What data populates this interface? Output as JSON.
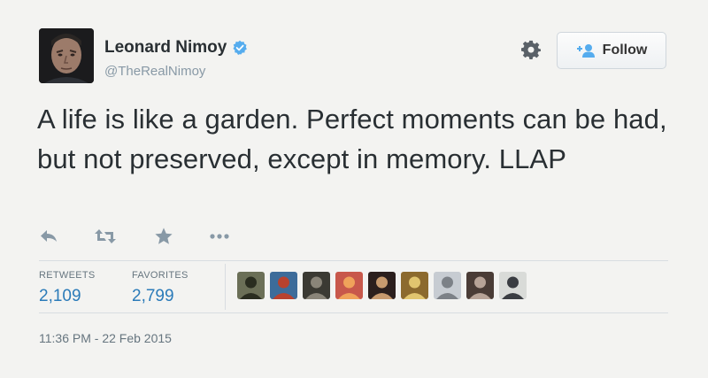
{
  "user": {
    "display_name": "Leonard Nimoy",
    "handle": "@TheRealNimoy",
    "verified": true,
    "avatar_icon": "profile-photo"
  },
  "follow_button": {
    "label": "Follow",
    "icon": "add-user-icon"
  },
  "settings_icon": "gear-icon",
  "tweet": {
    "text": "A life is like a garden. Perfect moments can be had, but not preserved, except in memory.  LLAP"
  },
  "actions": [
    "reply-icon",
    "retweet-icon",
    "favorite-icon",
    "more-icon"
  ],
  "stats": {
    "retweets_label": "RETWEETS",
    "retweets_value": "2,109",
    "favorites_label": "FAVORITES",
    "favorites_value": "2,799"
  },
  "favoriter_avatars": [
    {
      "name": "favoriter-avatar-1",
      "bg": "#6b6f57",
      "fg": "#2a2d20"
    },
    {
      "name": "favoriter-avatar-2",
      "bg": "#3d6c9a",
      "fg": "#b8422f"
    },
    {
      "name": "favoriter-avatar-3",
      "bg": "#3b3a33",
      "fg": "#8a8579"
    },
    {
      "name": "favoriter-avatar-4",
      "bg": "#c8584b",
      "fg": "#f0a25a"
    },
    {
      "name": "favoriter-avatar-5",
      "bg": "#2b1f1d",
      "fg": "#c79a6e"
    },
    {
      "name": "favoriter-avatar-6",
      "bg": "#8c6a2e",
      "fg": "#e1c56f"
    },
    {
      "name": "favoriter-avatar-7",
      "bg": "#c7ccd2",
      "fg": "#7c8187"
    },
    {
      "name": "favoriter-avatar-8",
      "bg": "#4a3c36",
      "fg": "#b7a397"
    },
    {
      "name": "favoriter-avatar-9",
      "bg": "#d9dbd8",
      "fg": "#3a3d42"
    }
  ],
  "timestamp": "11:36 PM - 22 Feb 2015",
  "colors": {
    "link_blue": "#2b7bb9",
    "verified_blue": "#55acee",
    "muted_text": "#66757f",
    "background": "#f3f3f1"
  }
}
